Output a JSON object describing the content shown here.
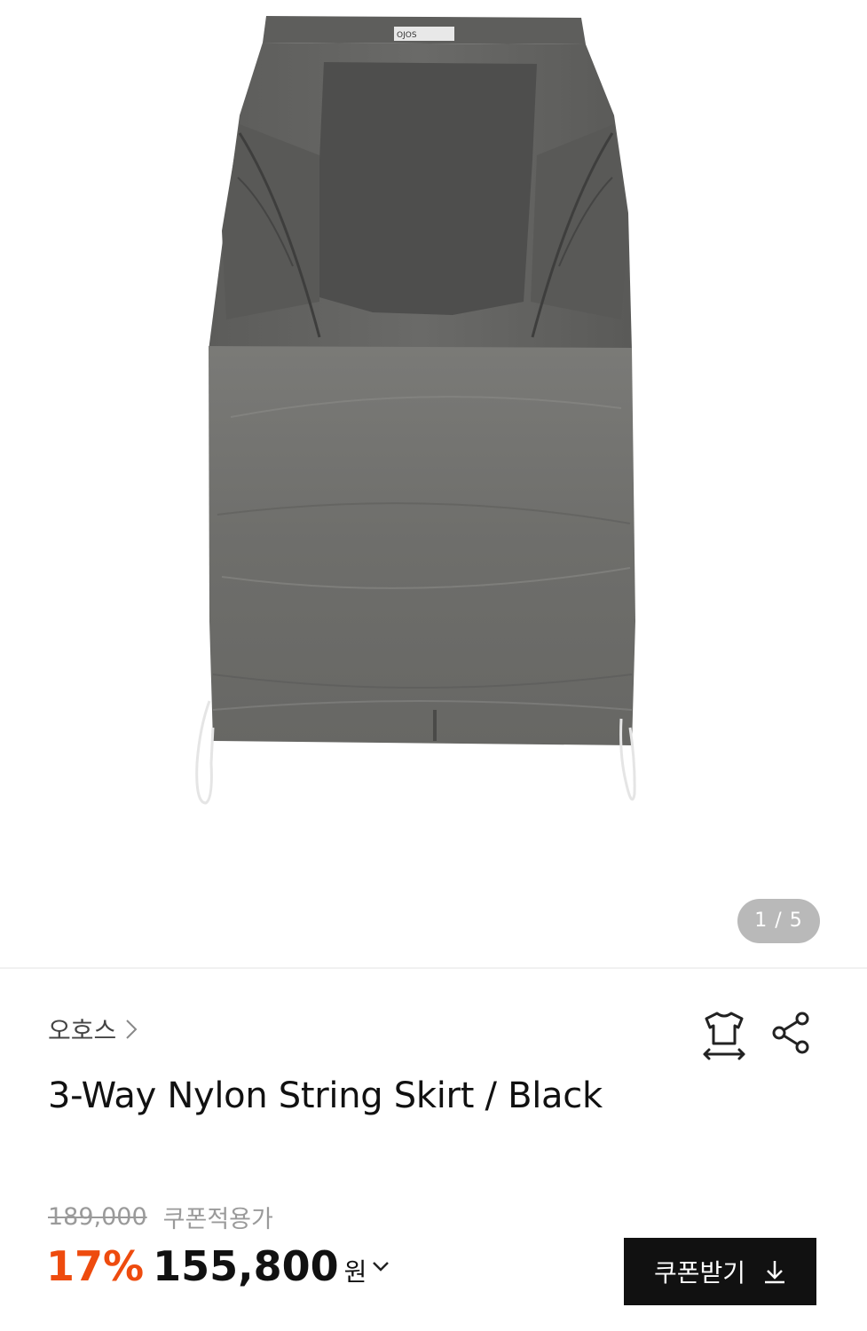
{
  "gallery": {
    "image_alt": "3-Way Nylon String Skirt / Black",
    "counter": "1 / 5"
  },
  "brand": {
    "name": "오호스"
  },
  "actions": {
    "size_icon": "tshirt-size-icon",
    "share_icon": "share-icon"
  },
  "product": {
    "title": "3-Way Nylon String Skirt / Black"
  },
  "pricing": {
    "original_price": "189,000",
    "coupon_note": "쿠폰적용가",
    "discount": "17%",
    "price": "155,800",
    "currency": "원",
    "accent_color": "#ee4b0e"
  },
  "coupon_button": {
    "label": "쿠폰받기",
    "icon": "download-icon"
  }
}
